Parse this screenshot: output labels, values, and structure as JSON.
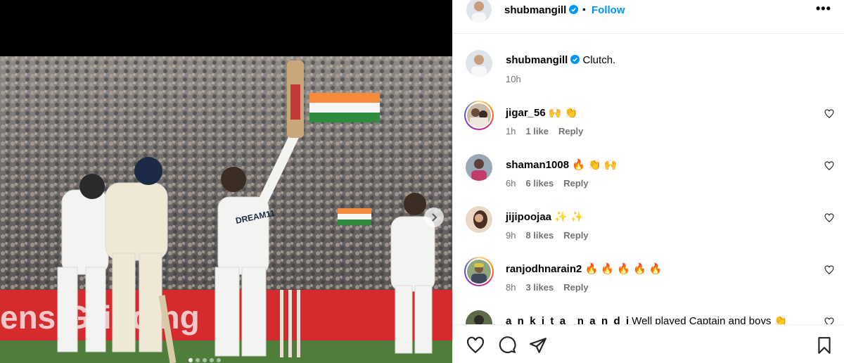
{
  "post": {
    "username": "shubmangill",
    "verified": true,
    "follow_label": "Follow",
    "separator": "•",
    "more_label": "•••",
    "caption": "Clutch.",
    "caption_time": "10h",
    "carousel": {
      "slide_count": 5,
      "active_index": 0
    },
    "photo_banner_text": "ens      Grinding"
  },
  "comments": [
    {
      "username": "jigar_56",
      "text": "🙌 👏",
      "time": "1h",
      "likes": "1 like",
      "reply": "Reply",
      "story_ring": true
    },
    {
      "username": "shaman1008",
      "text": "🔥 👏 🙌",
      "time": "6h",
      "likes": "6 likes",
      "reply": "Reply",
      "story_ring": false
    },
    {
      "username": "jijipoojaa",
      "text": "✨ ✨",
      "time": "9h",
      "likes": "8 likes",
      "reply": "Reply",
      "story_ring": false
    },
    {
      "username": "ranjodhnarain2",
      "text": "🔥 🔥 🔥 🔥 🔥",
      "time": "8h",
      "likes": "3 likes",
      "reply": "Reply",
      "story_ring": true
    },
    {
      "username": "a_n_k_i_t_a__n_a_n_d_i",
      "text": "Well played Captain and boys 👏",
      "time": "",
      "likes": "",
      "reply": "",
      "story_ring": false
    }
  ],
  "icons": {
    "like": "heart-icon",
    "comment": "comment-icon",
    "share": "send-icon",
    "save": "bookmark-icon",
    "next": "chevron-right-icon",
    "verified": "verified-badge-icon"
  },
  "colors": {
    "follow": "#0095f6",
    "verified": "#0095f6",
    "meta_text": "#737373",
    "border": "#efefef"
  }
}
